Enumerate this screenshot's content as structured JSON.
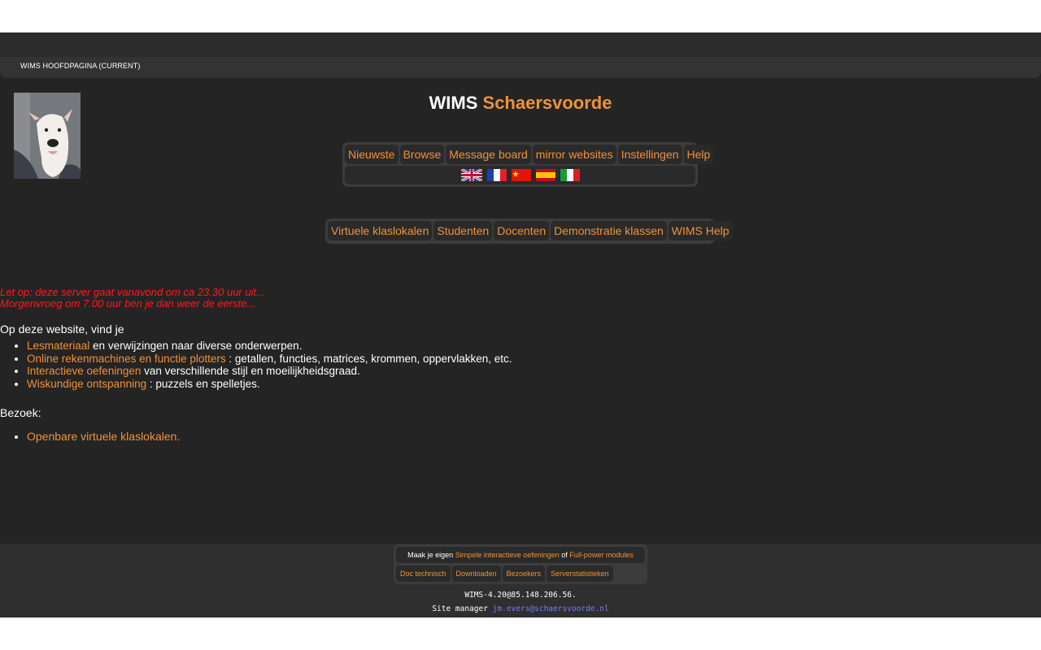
{
  "breadcrumb": "WIMS HOOFDPAGINA (CURRENT)",
  "site_title": {
    "prefix": "WIMS",
    "name": "Schaersvoorde"
  },
  "main_menu": [
    "Nieuwste",
    "Browse",
    "Message board",
    "mirror websites",
    "Instellingen",
    "Help"
  ],
  "languages": [
    "english-flag-icon",
    "french-flag-icon",
    "chinese-flag-icon",
    "spanish-flag-icon",
    "italian-flag-icon"
  ],
  "class_menu": [
    "Virtuele klaslokalen",
    "Studenten",
    "Docenten",
    "Demonstratie klassen",
    "WIMS Help"
  ],
  "notice": {
    "line1": "Let op: deze server gaat vanavond om ca 23.30 uur uit...",
    "line2": "Morgenvroeg om 7.00 uur ben je dan weer de eerste..."
  },
  "intro": "Op deze website, vind je",
  "features": [
    {
      "link": "Lesmateriaal",
      "text": " en verwijzingen naar diverse onderwerpen."
    },
    {
      "link": "Online rekenmachines en functie plotters",
      "text": " : getallen, functies, matrices, krommen, oppervlakken, etc."
    },
    {
      "link": "Interactieve oefeningen",
      "text": " van verschillende stijl en moeilijkheidsgraad."
    },
    {
      "link": "Wiskundige ontspanning",
      "text": " : puzzels en spelletjes."
    }
  ],
  "visit_label": "Bezoek:",
  "visit_links": [
    "Openbare virtuele klaslokalen."
  ],
  "footer": {
    "make_prefix": "Maak je eigen ",
    "make_link1": "Simpele interactieve oefeningen",
    "make_mid": " of ",
    "make_link2": "Full-power modules",
    "buttons": [
      "Doc technisch",
      "Downloaden",
      "Bezoekers",
      "Serverstatistieken"
    ],
    "version": "WIMS-4.20@85.148.206.56.",
    "manager_label": "Site manager ",
    "manager_email": "jm.evers@schaersvoorde.nl"
  },
  "colors": {
    "background": "#242424",
    "accent": "#f0913a",
    "notice": "#ff1a1a",
    "email": "#7a7aff"
  }
}
